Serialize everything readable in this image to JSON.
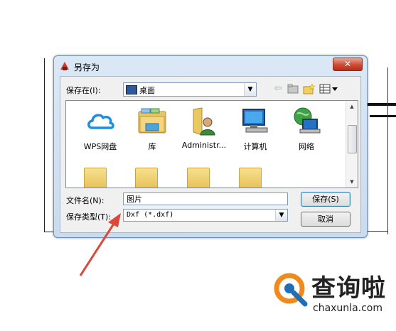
{
  "dialog": {
    "title": "另存为",
    "close_label": "✕"
  },
  "savein": {
    "label": "保存在(I):",
    "value": "桌面"
  },
  "files": [
    {
      "label": "WPS网盘",
      "icon": "cloud-icon"
    },
    {
      "label": "库",
      "icon": "library-icon"
    },
    {
      "label": "Administr...",
      "icon": "user-folder-icon"
    },
    {
      "label": "计算机",
      "icon": "computer-icon"
    },
    {
      "label": "网络",
      "icon": "network-icon"
    }
  ],
  "filename": {
    "label": "文件名(N):",
    "value": "图片"
  },
  "filetype": {
    "label": "保存类型(T):",
    "value": "Dxf (*.dxf)"
  },
  "buttons": {
    "save": "保存(S)",
    "cancel": "取消"
  },
  "watermark": {
    "text": "查询啦",
    "url": "chaxunla.com"
  },
  "colors": {
    "arrow": "#d8493a",
    "watermark_orange": "#f08a1d",
    "watermark_blue": "#1f6fb6"
  }
}
